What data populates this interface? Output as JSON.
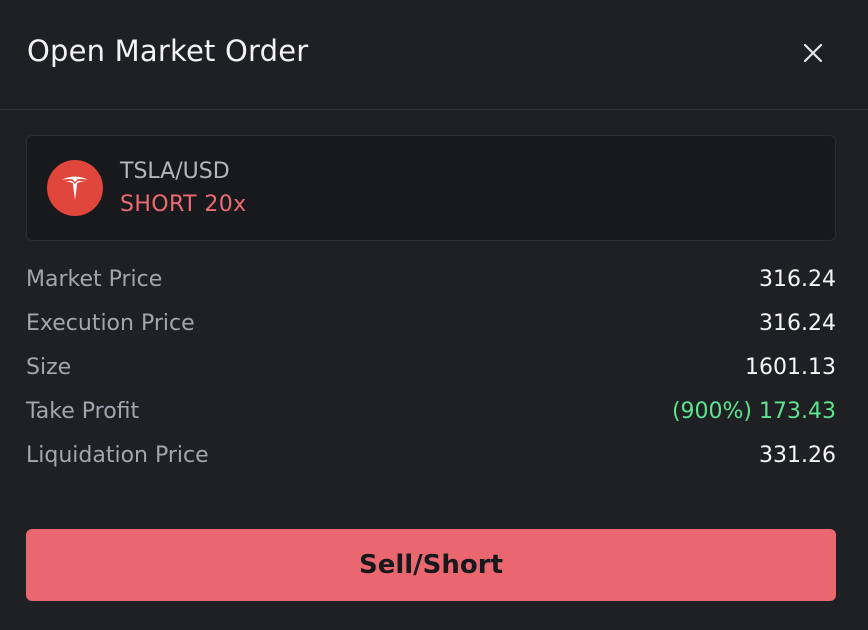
{
  "dialog": {
    "title": "Open Market Order",
    "close_icon": "close-icon"
  },
  "pair": {
    "logo_icon": "tesla-logo-icon",
    "name": "TSLA/USD",
    "side": "SHORT 20x",
    "side_color": "#ee6a72",
    "logo_color": "#e0463c"
  },
  "details": [
    {
      "label": "Market Price",
      "value": "316.24"
    },
    {
      "label": "Execution Price",
      "value": "316.24"
    },
    {
      "label": "Size",
      "value": "1601.13"
    },
    {
      "label": "Take Profit",
      "value": "(900%) 173.43",
      "value_color": "#5ee38f"
    },
    {
      "label": "Liquidation Price",
      "value": "331.26"
    }
  ],
  "action": {
    "label": "Sell/Short",
    "color": "#eb6770"
  }
}
